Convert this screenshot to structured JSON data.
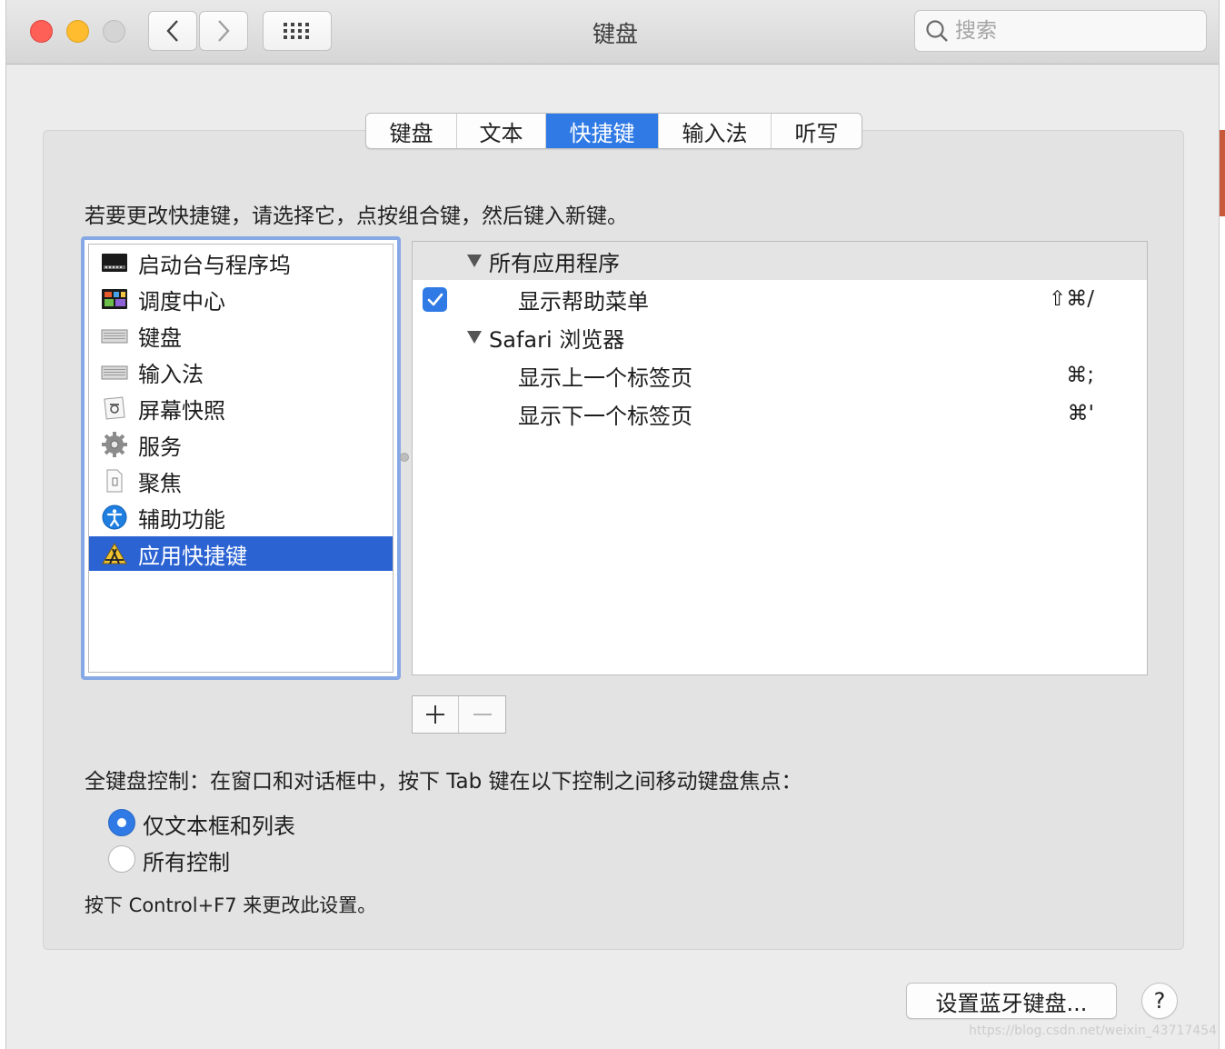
{
  "window": {
    "title": "键盘",
    "search_placeholder": "搜索"
  },
  "tabs": [
    {
      "label": "键盘",
      "active": false
    },
    {
      "label": "文本",
      "active": false
    },
    {
      "label": "快捷键",
      "active": true
    },
    {
      "label": "输入法",
      "active": false
    },
    {
      "label": "听写",
      "active": false
    }
  ],
  "instruction": "若要更改快捷键，请选择它，点按组合键，然后键入新键。",
  "categories": [
    {
      "label": "启动台与程序坞",
      "icon": "launchpad-dock-icon"
    },
    {
      "label": "调度中心",
      "icon": "mission-control-icon"
    },
    {
      "label": "键盘",
      "icon": "keyboard-icon"
    },
    {
      "label": "输入法",
      "icon": "input-source-icon"
    },
    {
      "label": "屏幕快照",
      "icon": "screenshot-icon"
    },
    {
      "label": "服务",
      "icon": "gear-icon"
    },
    {
      "label": "聚焦",
      "icon": "spotlight-icon"
    },
    {
      "label": "辅助功能",
      "icon": "accessibility-icon"
    },
    {
      "label": "应用快捷键",
      "icon": "app-shortcuts-icon",
      "selected": true
    }
  ],
  "shortcuts": {
    "group_all": "所有应用程序",
    "all_items": [
      {
        "name": "显示帮助菜单",
        "keys": "⇧⌘/",
        "checked": true
      }
    ],
    "group_safari": "Safari 浏览器",
    "safari_items": [
      {
        "name": "显示上一个标签页",
        "keys": "⌘;"
      },
      {
        "name": "显示下一个标签页",
        "keys": "⌘'"
      }
    ]
  },
  "full_keyboard": {
    "label": "全键盘控制：在窗口和对话框中，按下 Tab 键在以下控制之间移动键盘焦点：",
    "options": [
      {
        "label": "仅文本框和列表",
        "selected": true
      },
      {
        "label": "所有控制",
        "selected": false
      }
    ],
    "hint": "按下 Control+F7 来更改此设置。"
  },
  "buttons": {
    "bluetooth": "设置蓝牙键盘...",
    "help": "?"
  },
  "watermark": "https://blog.csdn.net/weixin_43717454",
  "colors": {
    "accent": "#2f7ae5",
    "selection": "#2b63d3"
  }
}
